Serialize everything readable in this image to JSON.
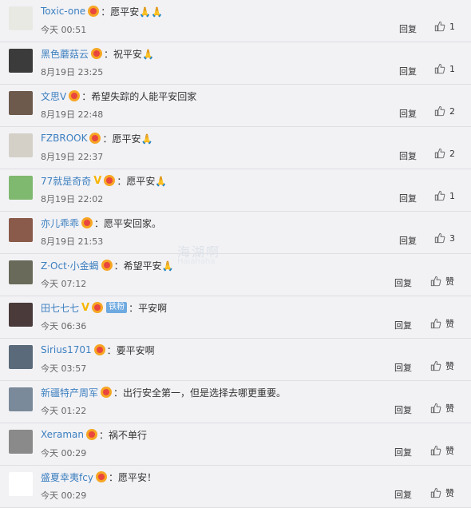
{
  "comments": [
    {
      "user": "Toxic-one",
      "content": "愿平安🙏🙏",
      "time": "今天 00:51",
      "reply": "回复",
      "likes": "1",
      "v": false,
      "fan": "",
      "avatar_color": "#e9e9e4"
    },
    {
      "user": "黑色蘑菇云",
      "content": "祝平安🙏",
      "time": "8月19日 23:25",
      "reply": "回复",
      "likes": "1",
      "v": false,
      "fan": "",
      "avatar_color": "#3b3b3b"
    },
    {
      "user": "文思V",
      "content": "希望失踪的人能平安回家",
      "time": "8月19日 22:48",
      "reply": "回复",
      "likes": "2",
      "v": false,
      "fan": "",
      "avatar_color": "#6d5a4c"
    },
    {
      "user": "FZBROOK",
      "content": "愿平安🙏",
      "time": "8月19日 22:37",
      "reply": "回复",
      "likes": "2",
      "v": false,
      "fan": "",
      "avatar_color": "#d4d0c8"
    },
    {
      "user": "77就是奇奇",
      "content": "愿平安🙏",
      "time": "8月19日 22:02",
      "reply": "回复",
      "likes": "1",
      "v": true,
      "fan": "",
      "avatar_color": "#7fb86f"
    },
    {
      "user": "亦儿乖乖",
      "content": "愿平安回家。",
      "time": "8月19日 21:53",
      "reply": "回复",
      "likes": "3",
      "v": false,
      "fan": "",
      "avatar_color": "#8a5a4a"
    },
    {
      "user": "Z·Oct·小金蝎",
      "content": "希望平安🙏",
      "time": "今天 07:12",
      "reply": "回复",
      "likes": "赞",
      "v": false,
      "fan": "",
      "avatar_color": "#6a6a5a"
    },
    {
      "user": "田七七七",
      "content": "平安啊",
      "time": "今天 06:36",
      "reply": "回复",
      "likes": "赞",
      "v": true,
      "fan": "铁粉",
      "avatar_color": "#4a3a3a"
    },
    {
      "user": "Sirius1701",
      "content": "要平安啊",
      "time": "今天 03:57",
      "reply": "回复",
      "likes": "赞",
      "v": false,
      "fan": "",
      "avatar_color": "#5a6a7a"
    },
    {
      "user": "新疆特产周军",
      "content": "出行安全第一，但是选择去哪更重要。",
      "time": "今天 01:22",
      "reply": "回复",
      "likes": "赞",
      "v": false,
      "fan": "",
      "avatar_color": "#7a8a9a"
    },
    {
      "user": "Xeraman",
      "content": "祸不单行",
      "time": "今天 00:29",
      "reply": "回复",
      "likes": "赞",
      "v": false,
      "fan": "",
      "avatar_color": "#8a8a8a"
    },
    {
      "user": "盛夏幸夷fcy",
      "content": "愿平安！",
      "time": "今天 00:29",
      "reply": "回复",
      "likes": "赞",
      "v": false,
      "fan": "",
      "avatar_color": "#ffffff"
    }
  ],
  "watermark": {
    "line1": "海湖啊",
    "line2": "Haiahaha"
  }
}
